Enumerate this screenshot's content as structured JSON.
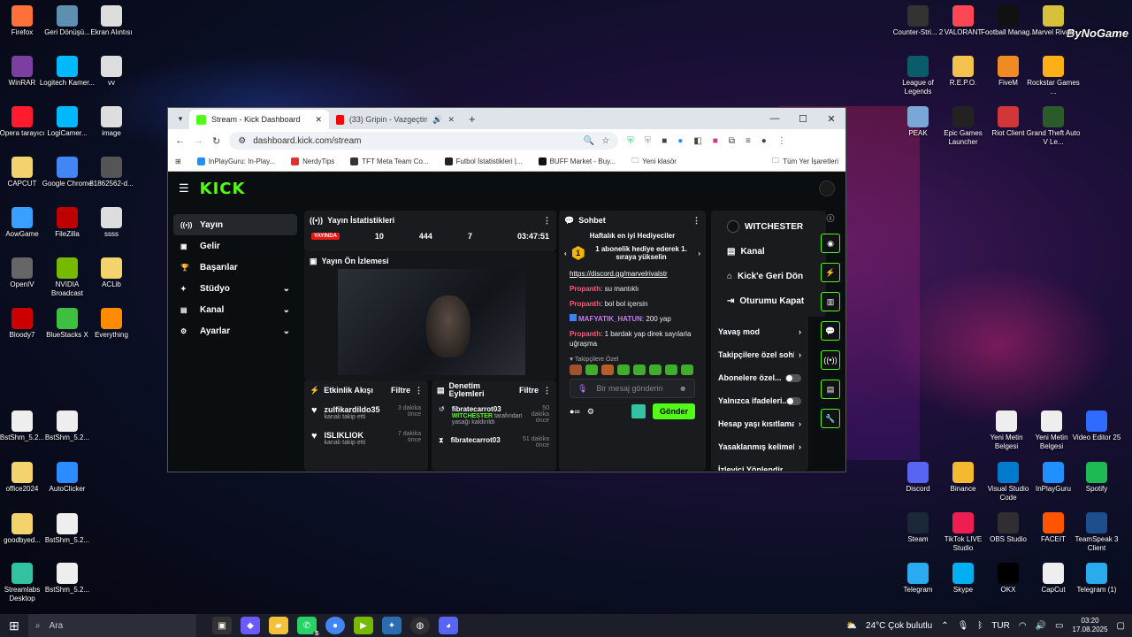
{
  "desktop": {
    "watermark": "ByNoGame",
    "left_icons": [
      {
        "label": "Firefox",
        "color": "#ff7139"
      },
      {
        "label": "Geri Dönüşü...",
        "color": "#5f8fb0"
      },
      {
        "label": "Ekran Alıntısı",
        "color": "#ddd"
      },
      {
        "label": "WinRAR",
        "color": "#7b3fa0"
      },
      {
        "label": "Logitech Kamer...",
        "color": "#00b8fc"
      },
      {
        "label": "vv",
        "color": "#ddd"
      },
      {
        "label": "Opera tarayıcı",
        "color": "#ff1b2d"
      },
      {
        "label": "LogiCamer...",
        "color": "#00b8fc"
      },
      {
        "label": "image",
        "color": "#ddd"
      },
      {
        "label": "CAPCUT",
        "color": "#f3d36b"
      },
      {
        "label": "Google Chrome",
        "color": "#4285f4"
      },
      {
        "label": "81862562-d...",
        "color": "#555"
      },
      {
        "label": "AowGame",
        "color": "#3aa0ff"
      },
      {
        "label": "FileZilla",
        "color": "#bf0000"
      },
      {
        "label": "ssss",
        "color": "#ddd"
      },
      {
        "label": "OpenIV",
        "color": "#666"
      },
      {
        "label": "NVIDIA Broadcast",
        "color": "#76b900"
      },
      {
        "label": "ACLib",
        "color": "#f3d36b"
      },
      {
        "label": "Bloody7",
        "color": "#c00"
      },
      {
        "label": "BlueStacks X",
        "color": "#3fbf3f"
      },
      {
        "label": "Everything",
        "color": "#ff8c00"
      },
      {
        "label": "BstShm_5.2...",
        "color": "#eee"
      },
      {
        "label": "BstShm_5.2...",
        "color": "#eee"
      },
      {
        "label": "office2024",
        "color": "#f3d36b"
      },
      {
        "label": "AutoClicker",
        "color": "#2a8cff"
      },
      {
        "label": "goodbyed...",
        "color": "#f3d36b"
      },
      {
        "label": "BstShm_5.2...",
        "color": "#eee"
      },
      {
        "label": "Streamlabs Desktop",
        "color": "#31c3a2"
      },
      {
        "label": "BstShm_5.2...",
        "color": "#eee"
      }
    ],
    "right_icons": [
      {
        "label": "Counter-Stri... 2",
        "color": "#333"
      },
      {
        "label": "VALORANT",
        "color": "#ff4655"
      },
      {
        "label": "Football Manag...",
        "color": "#111"
      },
      {
        "label": "Marvel Rivals",
        "color": "#d8c13a"
      },
      {
        "label": "League of Legends",
        "color": "#0a5c6a"
      },
      {
        "label": "R.E.P.O.",
        "color": "#f2c14e"
      },
      {
        "label": "FiveM",
        "color": "#f08a24"
      },
      {
        "label": "Rockstar Games ...",
        "color": "#fcaf17"
      },
      {
        "label": "PEAK",
        "color": "#7aa6d8"
      },
      {
        "label": "Epic Games Launcher",
        "color": "#222"
      },
      {
        "label": "Riot Client",
        "color": "#d13639"
      },
      {
        "label": "Grand Theft Auto V Le...",
        "color": "#2b5a2b"
      },
      {
        "label": "Yeni Metin Belgesi",
        "color": "#eee"
      },
      {
        "label": "Yeni Metin Belgesi",
        "color": "#eee"
      },
      {
        "label": "Video Editor 25",
        "color": "#2f6bff"
      },
      {
        "label": "Discord",
        "color": "#5865f2"
      },
      {
        "label": "Binance",
        "color": "#f3ba2f"
      },
      {
        "label": "Visual Studio Code",
        "color": "#007acc"
      },
      {
        "label": "InPlayGuru",
        "color": "#1e90ff"
      },
      {
        "label": "Spotify",
        "color": "#1db954"
      },
      {
        "label": "Steam",
        "color": "#1b2838"
      },
      {
        "label": "TikTok LIVE Studio",
        "color": "#ee1d52"
      },
      {
        "label": "OBS Studio",
        "color": "#302e31"
      },
      {
        "label": "FACEIT",
        "color": "#ff5500"
      },
      {
        "label": "TeamSpeak 3 Client",
        "color": "#1f4e8c"
      },
      {
        "label": "Telegram",
        "color": "#2aabee"
      },
      {
        "label": "Skype",
        "color": "#00aff0"
      },
      {
        "label": "OKX",
        "color": "#000"
      },
      {
        "label": "CapCut",
        "color": "#eee"
      },
      {
        "label": "Telegram (1)",
        "color": "#2aabee"
      }
    ]
  },
  "browser": {
    "tabs": [
      {
        "title": "Stream - Kick Dashboard",
        "active": true
      },
      {
        "title": "(33) Gripin - Vazgeçtim Ben",
        "active": false
      }
    ],
    "new_tab": "+",
    "url": "dashboard.kick.com/stream",
    "bookmarks": [
      "InPlayGuru: In-Play...",
      "NerdyTips",
      "TFT Meta Team Co...",
      "Futbol İstatistikleri |...",
      "BUFF Market - Buy...",
      "Yeni klasör",
      "Tüm Yer İşaretleri"
    ]
  },
  "kick": {
    "logo": "KICK",
    "sidebar": [
      {
        "label": "Yayın",
        "icon": "broadcast-icon",
        "active": true,
        "chevron": false
      },
      {
        "label": "Gelir",
        "icon": "wallet-icon",
        "active": false,
        "chevron": false
      },
      {
        "label": "Başarılar",
        "icon": "trophy-icon",
        "active": false,
        "chevron": false
      },
      {
        "label": "Stüdyo",
        "icon": "studio-icon",
        "active": false,
        "chevron": true
      },
      {
        "label": "Kanal",
        "icon": "channel-icon",
        "active": false,
        "chevron": true
      },
      {
        "label": "Ayarlar",
        "icon": "gear-icon",
        "active": false,
        "chevron": true
      }
    ],
    "stats": {
      "title": "Yayın İstatistikleri",
      "live": "YAYINDA",
      "values": [
        "10",
        "444",
        "7",
        "03:47:51"
      ]
    },
    "preview": {
      "title": "Yayın Ön İzlemesi"
    },
    "activity": {
      "title": "Etkinlik Akışı",
      "filter": "Filtre",
      "items": [
        {
          "name": "zulfikardildo35",
          "sub": "kanalı takip etti",
          "time": "3 dakika önce"
        },
        {
          "name": "ISLIKLIOK",
          "sub": "kanalı takip etti",
          "time": "7 dakika önce"
        }
      ]
    },
    "moderation": {
      "title": "Denetim Eylemleri",
      "filter": "Filtre",
      "items": [
        {
          "name": "fibratecarrot03",
          "time": "50 dakika önce",
          "actor": "WITCHESTER",
          "sub": "tarafından yasağı kaldırıldı"
        },
        {
          "name": "fibratecarrot03",
          "time": "51 dakika önce"
        }
      ]
    },
    "chat": {
      "title": "Sohbet",
      "gifters_title": "Haftalık en iyi Hediyeciler",
      "gifters_rank": "1",
      "gifters_msg": "1 abonelik hediye ederek 1. sıraya yükselin",
      "link": "https://discord.gg/marvelrivalstr",
      "messages": [
        {
          "user": "Propanth",
          "text": "su mantıklı"
        },
        {
          "user": "Propanth",
          "text": "bol bol içersin"
        },
        {
          "user": "MAFYATIK_HATUN",
          "text": "200 yap"
        },
        {
          "user": "Propanth",
          "text": "1 bardak yap direk sayılarla uğraşma"
        }
      ],
      "follower_emotes": "Takipçilere Özel",
      "placeholder": "Bir mesaj gönderin",
      "send": "Gönder"
    },
    "user_menu": {
      "username": "WITCHESTER",
      "items": [
        "Kanal",
        "Kick'e Geri Dön",
        "Oturumu Kapat"
      ]
    },
    "chat_settings": [
      {
        "label": "Yavaş mod",
        "control": "chevron"
      },
      {
        "label": "Takipçilere özel sohb",
        "control": "chevron"
      },
      {
        "label": "Abonelere özel...",
        "control": "toggle"
      },
      {
        "label": "Yalnızca ifadeleri...",
        "control": "toggle"
      },
      {
        "label": "Hesap yaşı kısıtlamas",
        "control": "chevron"
      },
      {
        "label": "Yasaklanmış kelimele",
        "control": "chevron"
      },
      {
        "label": "İzleyici Yönlendir",
        "control": "none"
      }
    ]
  },
  "taskbar": {
    "search": "Ara",
    "weather": "24°C  Çok bulutlu",
    "lang": "TUR",
    "time": "03:20",
    "date": "17.08.2025",
    "whatsapp_badge": "5"
  }
}
